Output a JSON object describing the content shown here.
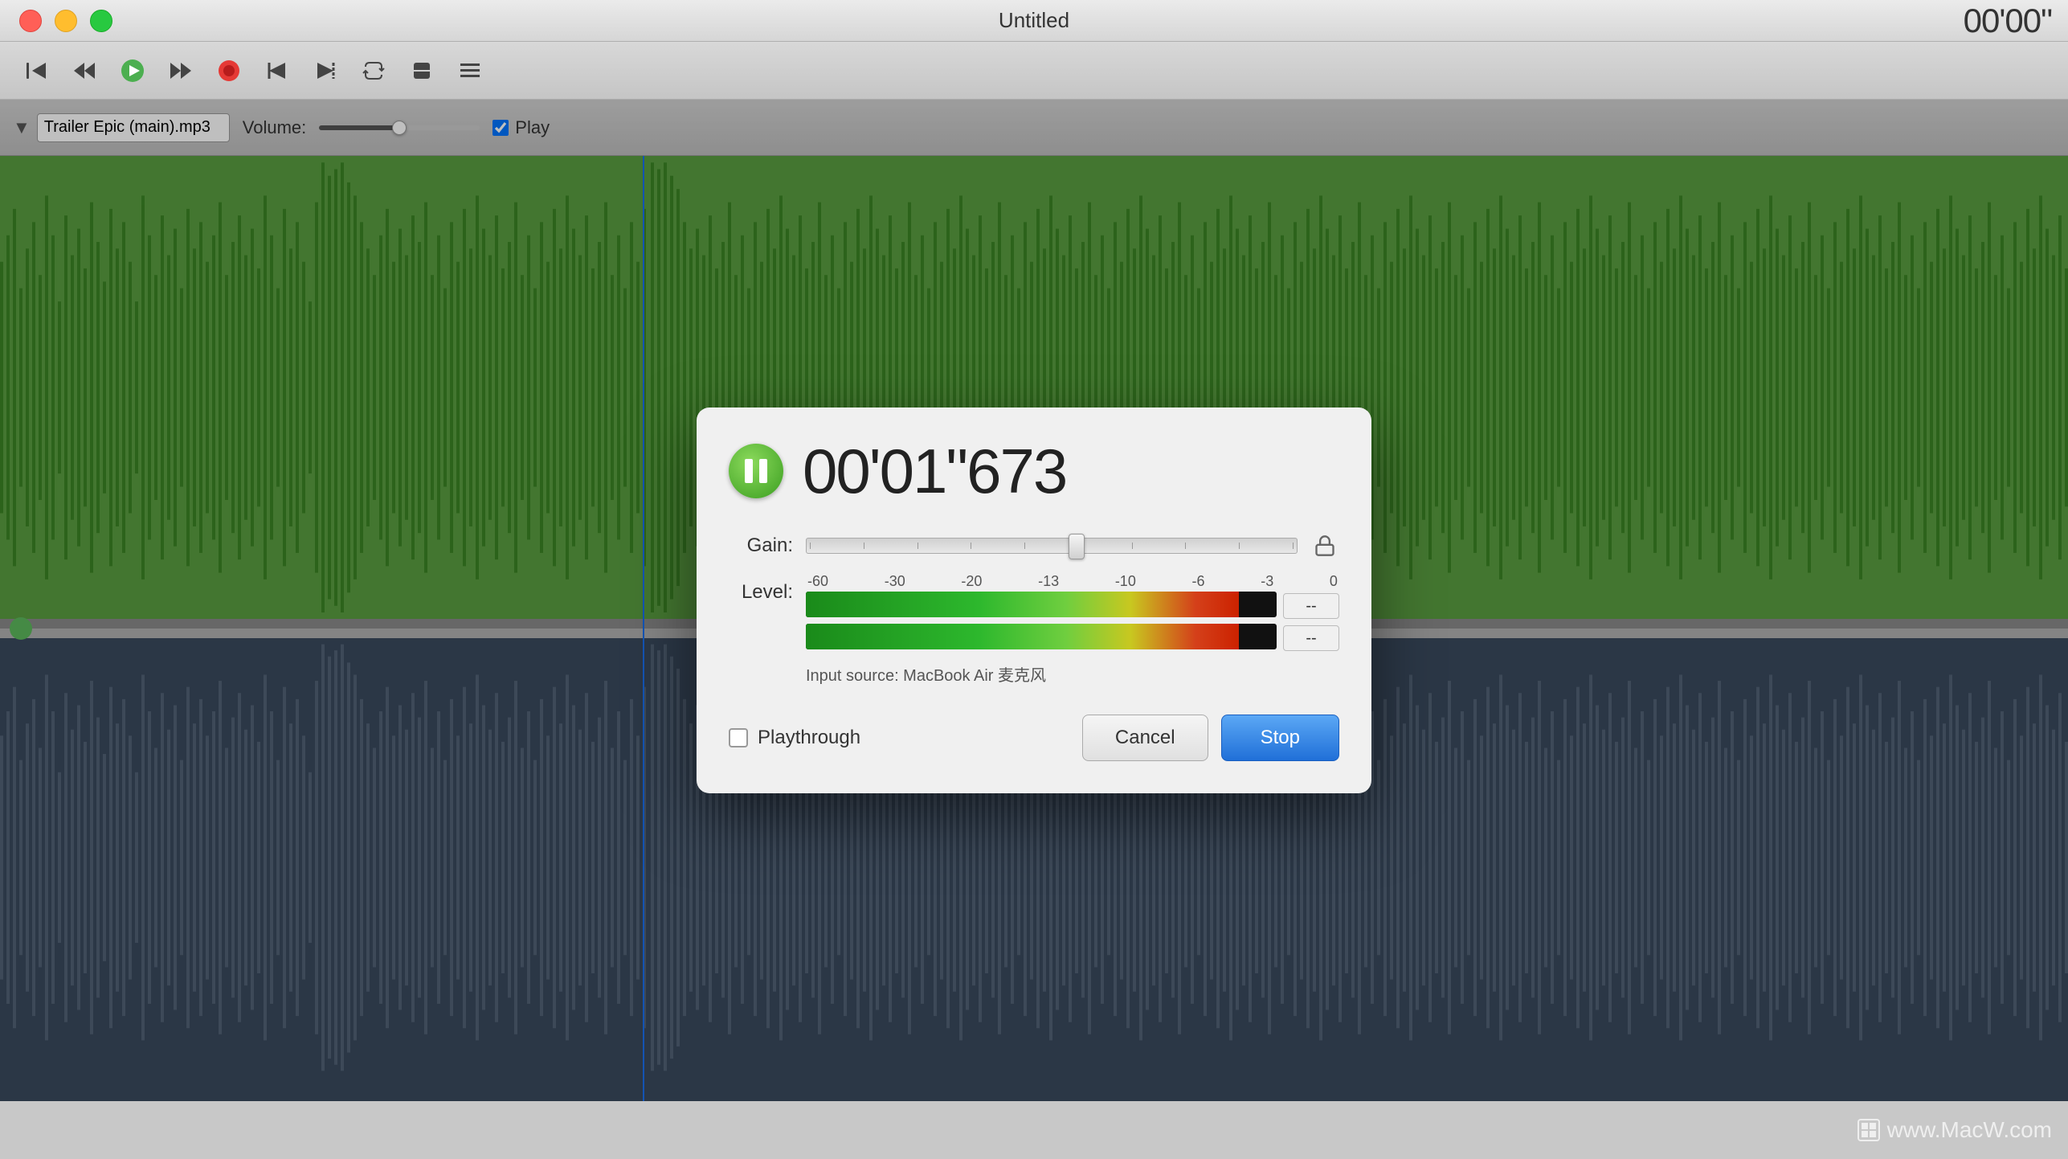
{
  "window": {
    "title": "Untitled",
    "timer_corner": "00'00\""
  },
  "toolbar": {
    "buttons": [
      {
        "name": "back-to-start",
        "label": "⏮"
      },
      {
        "name": "rewind",
        "label": "⏪"
      },
      {
        "name": "play",
        "label": "▶"
      },
      {
        "name": "fast-forward",
        "label": "⏩"
      },
      {
        "name": "record",
        "label": "⏺"
      },
      {
        "name": "skip-back",
        "label": "⏭"
      },
      {
        "name": "skip-forward",
        "label": "⏭"
      },
      {
        "name": "loop",
        "label": "🔁"
      },
      {
        "name": "stop2",
        "label": "⏹"
      },
      {
        "name": "trim",
        "label": "✂"
      }
    ]
  },
  "track": {
    "filename": "Trailer Epic (main).mp3",
    "volume_label": "Volume:",
    "play_label": "Play"
  },
  "dialog": {
    "time": "00'01\"673",
    "gain_label": "Gain:",
    "level_label": "Level:",
    "scale": [
      "-60",
      "-30",
      "-20",
      "-13",
      "-10",
      "-6",
      "-3",
      "0"
    ],
    "level_value1": "--",
    "level_value2": "--",
    "input_source": "Input source: MacBook Air 麦克风",
    "playthrough_label": "Playthrough",
    "cancel_label": "Cancel",
    "stop_label": "Stop"
  },
  "watermark": {
    "text": "www.MacW.com"
  }
}
